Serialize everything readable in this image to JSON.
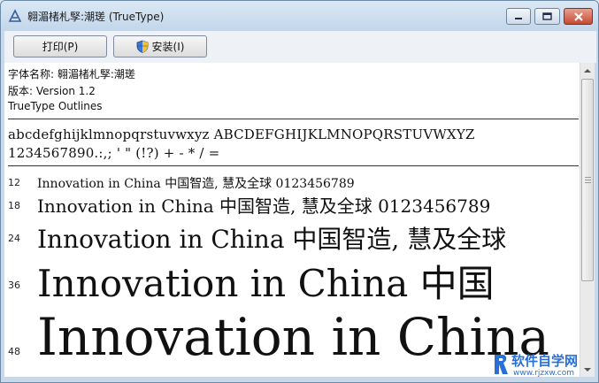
{
  "window": {
    "title": "翱湄楮札孯:潮瑳 (TrueType)",
    "minimize_icon": "minimize-icon",
    "maximize_icon": "maximize-icon",
    "close_icon": "close-icon"
  },
  "toolbar": {
    "print_label": "打印(P)",
    "install_label": "安装(I)",
    "install_icon": "uac-shield-icon"
  },
  "font_info": {
    "name_line": "字体名称: 翱湄楮札孯:潮瑳",
    "version_line": "版本: Version 1.2",
    "outline_line": "TrueType Outlines"
  },
  "charset": {
    "letters": "abcdefghijklmnopqrstuvwxyz ABCDEFGHIJKLMNOPQRSTUVWXYZ",
    "digits": "1234567890.:,; ' \" (!?) + - * / ="
  },
  "samples": [
    {
      "size": "12",
      "text": "Innovation in China 中国智造, 慧及全球 0123456789"
    },
    {
      "size": "18",
      "text": "Innovation in China 中国智造, 慧及全球 0123456789"
    },
    {
      "size": "24",
      "text": "Innovation in China 中国智造, 慧及全球"
    },
    {
      "size": "36",
      "text": "Innovation in China 中国"
    },
    {
      "size": "48",
      "text": "Innovation in China"
    }
  ],
  "watermark": {
    "main": "软件自学网",
    "sub": "www.rjzxw.com"
  },
  "colors": {
    "title_bar": "#c2d6ea",
    "close_button": "#c64a33",
    "watermark": "#2a6fd6"
  }
}
